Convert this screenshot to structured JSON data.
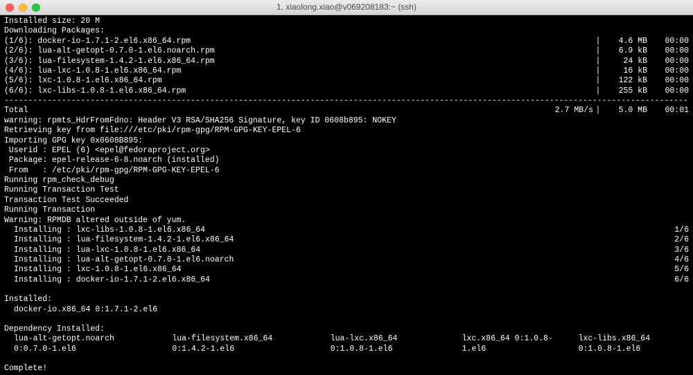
{
  "window": {
    "title": "1. xiaolong.xiao@v069208183:~ (ssh)"
  },
  "preamble": {
    "installed_size": "Installed size: 20 M",
    "downloading": "Downloading Packages:"
  },
  "downloads": [
    {
      "label": "(1/6): docker-io-1.7.1-2.el6.x86_64.rpm",
      "size": "4.6 MB",
      "time": "00:00"
    },
    {
      "label": "(2/6): lua-alt-getopt-0.7.0-1.el6.noarch.rpm",
      "size": "6.9 kB",
      "time": "00:00"
    },
    {
      "label": "(3/6): lua-filesystem-1.4.2-1.el6.x86_64.rpm",
      "size": "24 kB",
      "time": "00:00"
    },
    {
      "label": "(4/6): lua-lxc-1.0.8-1.el6.x86_64.rpm",
      "size": "16 kB",
      "time": "00:00"
    },
    {
      "label": "(5/6): lxc-1.0.8-1.el6.x86_64.rpm",
      "size": "122 kB",
      "time": "00:00"
    },
    {
      "label": "(6/6): lxc-libs-1.0.8-1.el6.x86_64.rpm",
      "size": "255 kB",
      "time": "00:00"
    }
  ],
  "total": {
    "label": "Total",
    "rate": "2.7 MB/s",
    "size": "5.0 MB",
    "time": "00:01"
  },
  "messages": [
    "warning: rpmts_HdrFromFdno: Header V3 RSA/SHA256 Signature, key ID 0608b895: NOKEY",
    "Retrieving key from file:///etc/pki/rpm-gpg/RPM-GPG-KEY-EPEL-6",
    "Importing GPG key 0x0608B895:",
    " Userid : EPEL (6) <epel@fedoraproject.org>",
    " Package: epel-release-6-8.noarch (installed)",
    " From   : /etc/pki/rpm-gpg/RPM-GPG-KEY-EPEL-6",
    "Running rpm_check_debug",
    "Running Transaction Test",
    "Transaction Test Succeeded",
    "Running Transaction",
    "Warning: RPMDB altered outside of yum."
  ],
  "installs": [
    {
      "pkg": "Installing : lxc-libs-1.0.8-1.el6.x86_64",
      "count": "1/6"
    },
    {
      "pkg": "Installing : lua-filesystem-1.4.2-1.el6.x86_64",
      "count": "2/6"
    },
    {
      "pkg": "Installing : lua-lxc-1.0.8-1.el6.x86_64",
      "count": "3/6"
    },
    {
      "pkg": "Installing : lua-alt-getopt-0.7.0-1.el6.noarch",
      "count": "4/6"
    },
    {
      "pkg": "Installing : lxc-1.0.8-1.el6.x86_64",
      "count": "5/6"
    },
    {
      "pkg": "Installing : docker-io-1.7.1-2.el6.x86_64",
      "count": "6/6"
    }
  ],
  "installed_header": "Installed:",
  "installed_pkg": "docker-io.x86_64 0:1.7.1-2.el6",
  "deps_header": "Dependency Installed:",
  "deps": [
    "lua-alt-getopt.noarch 0:0.7.0-1.el6",
    "lua-filesystem.x86_64 0:1.4.2-1.el6",
    "lua-lxc.x86_64 0:1.0.8-1.el6",
    "lxc.x86_64 0:1.0.8-1.el6",
    "lxc-libs.x86_64 0:1.0.8-1.el6"
  ],
  "complete": "Complete!",
  "hr": "----------------------------------------------------------------------------------------------------------------------------------------------------------------"
}
